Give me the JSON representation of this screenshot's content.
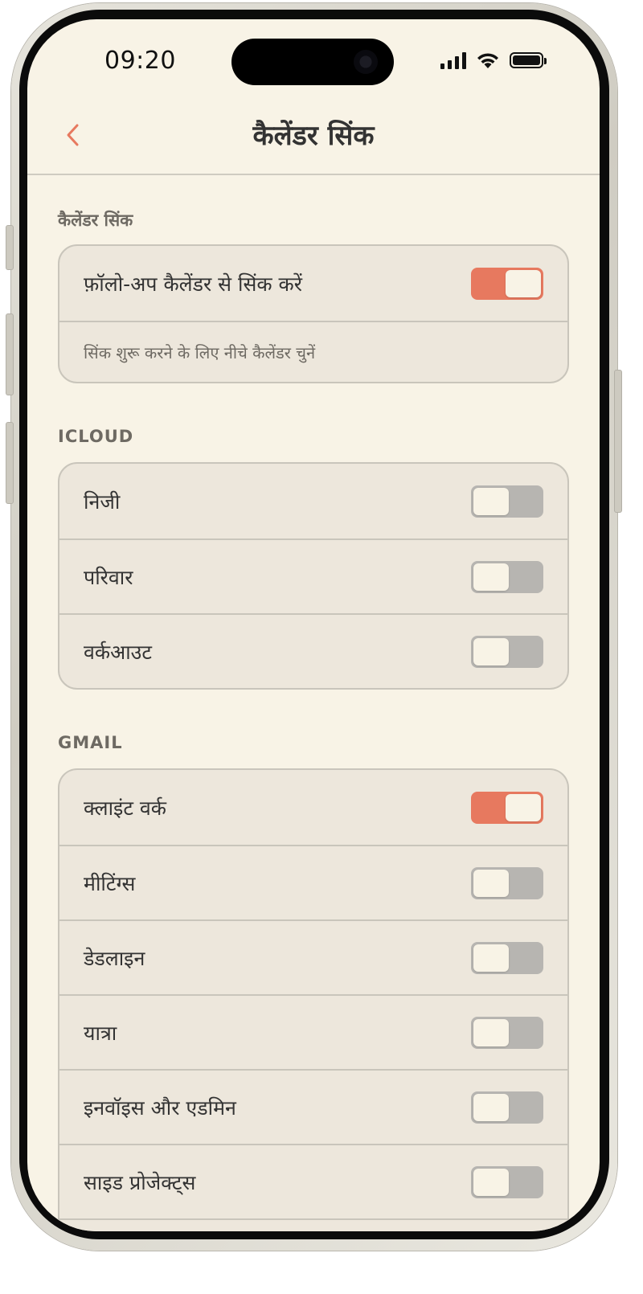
{
  "status_bar": {
    "time": "09:20"
  },
  "header": {
    "title": "कैलेंडर सिंक"
  },
  "colors": {
    "accent": "#e7795f",
    "background": "#f8f3e6",
    "card": "#ede7dc",
    "toggle_off": "#b7b5b1"
  },
  "sections": {
    "sync": {
      "header": "कैलेंडर सिंक",
      "toggle_label": "फ़ॉलो-अप कैलेंडर से सिंक करें",
      "toggle_on": true,
      "hint": "सिंक शुरू करने के लिए नीचे कैलेंडर चुनें"
    },
    "icloud": {
      "header": "ICLOUD",
      "items": [
        {
          "label": "निजी",
          "on": false
        },
        {
          "label": "परिवार",
          "on": false
        },
        {
          "label": "वर्कआउट",
          "on": false
        }
      ]
    },
    "gmail": {
      "header": "GMAIL",
      "items": [
        {
          "label": "क्लाइंट वर्क",
          "on": true
        },
        {
          "label": "मीटिंग्स",
          "on": false
        },
        {
          "label": "डेडलाइन",
          "on": false
        },
        {
          "label": "यात्रा",
          "on": false
        },
        {
          "label": "इनवॉइस और एडमिन",
          "on": false
        },
        {
          "label": "साइड प्रोजेक्ट्स",
          "on": false
        }
      ]
    }
  }
}
